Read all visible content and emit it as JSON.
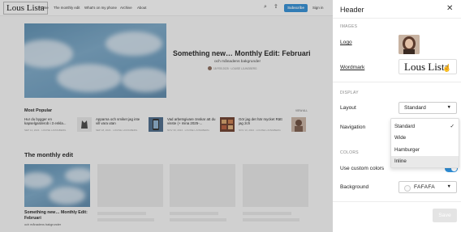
{
  "site": {
    "logo_text": "Lous Lista",
    "nav": [
      "Home",
      "The monthly edit",
      "What's on my phone",
      "Archive",
      "About"
    ],
    "subscribe_label": "Subscribe",
    "signin_label": "Sign in",
    "hero": {
      "title": "Something new… Monthly Edit: Februari",
      "subtitle": "och månadens bakgrunder",
      "meta": "18 FEB 2025 · LOUISE LJUNGBERG"
    },
    "most_popular": {
      "heading": "Most Popular",
      "view_all": "VIEW ALL",
      "items": [
        {
          "title": "Hur du bygger en kapselgarderob i 3 enkla...",
          "meta": "SEP 14, 2024 · LOUISE LJUNGBERG"
        },
        {
          "title": "Apparna och smiket jag inte vill vara utan",
          "meta": "SEP 18, 2024 · LOUISE LJUNGBERG"
        },
        {
          "title": "Vad arbetsgivare önskar att du visste (+ mina 2025-...",
          "meta": "NOV 30, 2024 · LOUISE LJUNGBERG"
        },
        {
          "title": "Gör jag det här mycket Rätt jag 2ch",
          "meta": "NOV 13, 2024 · LOUISE LJUNGBERG"
        }
      ]
    },
    "monthly_edit": {
      "heading": "The monthly edit",
      "card_title": "Something new… Monthly Edit: Februari",
      "card_sub": "och månadens bakgrunder",
      "card_meta": "18 FEB 2025 · LOUISE LJUNGBERG"
    }
  },
  "panel": {
    "title": "Header",
    "close_icon": "close-icon",
    "sections": {
      "images": "IMAGES",
      "display": "DISPLAY",
      "colors": "COLORS"
    },
    "logo_label": "Logo",
    "wordmark_label": "Wordmark",
    "wordmark_text": "Lous Lista",
    "layout_label": "Layout",
    "layout_value": "Standard",
    "navigation_label": "Navigation",
    "navigation_options": [
      {
        "label": "Standard",
        "selected": true
      },
      {
        "label": "Wide",
        "selected": false
      },
      {
        "label": "Hamburger",
        "selected": false
      },
      {
        "label": "Inline",
        "selected": false
      }
    ],
    "custom_colors_label": "Use custom colors",
    "custom_colors_on": true,
    "background_label": "Background",
    "background_value": "FAFAFA",
    "save_label": "Save"
  },
  "colors": {
    "accent": "#2f8fd8",
    "background": "#fafafa"
  }
}
